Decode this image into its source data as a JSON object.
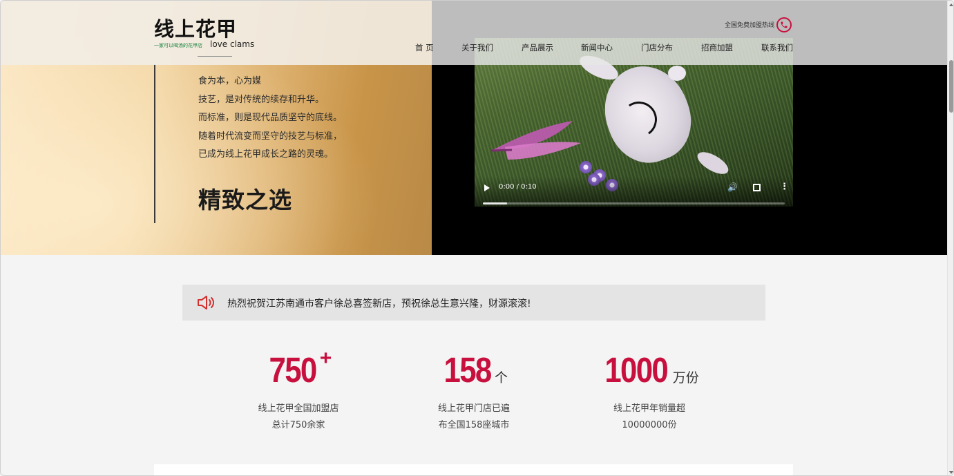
{
  "header": {
    "logo_cn": "线上花甲",
    "logo_slogan": "一家可以喝汤的花甲店",
    "logo_en": "love clams",
    "hotline_label": "全国免费加盟热线",
    "nav": [
      "首 页",
      "关于我们",
      "产品展示",
      "新闻中心",
      "门店分布",
      "招商加盟",
      "联系我们"
    ]
  },
  "hero": {
    "lines": [
      "食为本，心为媒",
      "技艺，是对传统的续存和升华。",
      "而标准，则是现代品质坚守的底线。",
      "随着时代流变而坚守的技艺与标准，",
      "已成为线上花甲成长之路的灵魂。"
    ],
    "title": "精致之选"
  },
  "video": {
    "time": "0:00 / 0:10",
    "progress_fraction": 0.08
  },
  "notice": {
    "text": "热烈祝贺江苏南通市客户徐总喜签新店，预祝徐总生意兴隆，财源滚滚!"
  },
  "stats": [
    {
      "number": "750",
      "unit": "+",
      "desc1": "线上花甲全国加盟店",
      "desc2": "总计750余家"
    },
    {
      "number": "158",
      "unit": "个",
      "desc1": "线上花甲门店已遍",
      "desc2": "布全国158座城市"
    },
    {
      "number": "1000",
      "unit": "万份",
      "desc1": "线上花甲年销量超",
      "desc2": "10000000份"
    }
  ],
  "colors": {
    "accent": "#c8103e",
    "hero_gold": "#c89448",
    "notice_bg": "#e4e4e4"
  }
}
